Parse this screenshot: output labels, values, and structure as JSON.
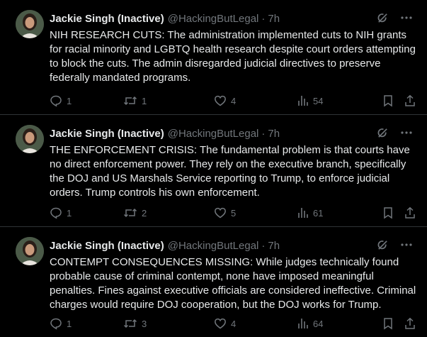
{
  "tweets": [
    {
      "author": {
        "name": "Jackie Singh (Inactive)",
        "handle": "@HackingButLegal"
      },
      "time": "7h",
      "separator": "·",
      "text": "NIH RESEARCH CUTS: The administration implemented cuts to NIH grants for racial minority and LGBTQ health research despite court orders attempting to block the cuts. The admin disregarded judicial directives to preserve federally mandated programs.",
      "stats": {
        "replies": "1",
        "reposts": "1",
        "likes": "4",
        "views": "54"
      }
    },
    {
      "author": {
        "name": "Jackie Singh (Inactive)",
        "handle": "@HackingButLegal"
      },
      "time": "7h",
      "separator": "·",
      "text": "THE ENFORCEMENT CRISIS: The fundamental problem is that courts have no direct enforcement power. They rely on the executive branch, specifically the DOJ and US Marshals Service reporting to Trump, to enforce judicial orders. Trump controls his own enforcement.",
      "stats": {
        "replies": "1",
        "reposts": "2",
        "likes": "5",
        "views": "61"
      }
    },
    {
      "author": {
        "name": "Jackie Singh (Inactive)",
        "handle": "@HackingButLegal"
      },
      "time": "7h",
      "separator": "·",
      "text": "CONTEMPT CONSEQUENCES MISSING: While judges technically found probable cause of criminal contempt, none have imposed meaningful penalties. Fines against executive officials are considered ineffective. Criminal charges would require DOJ cooperation, but the DOJ works for Trump.",
      "stats": {
        "replies": "1",
        "reposts": "3",
        "likes": "4",
        "views": "64"
      }
    }
  ],
  "icons": {
    "reply": "reply-icon",
    "repost": "repost-icon",
    "like": "heart-icon",
    "views": "views-icon",
    "bookmark": "bookmark-icon",
    "share": "share-icon",
    "grok": "grok-icon",
    "more": "more-icon"
  },
  "colors": {
    "background": "#000000",
    "text": "#e7e9ea",
    "muted": "#71767b",
    "divider": "#2f3336"
  }
}
